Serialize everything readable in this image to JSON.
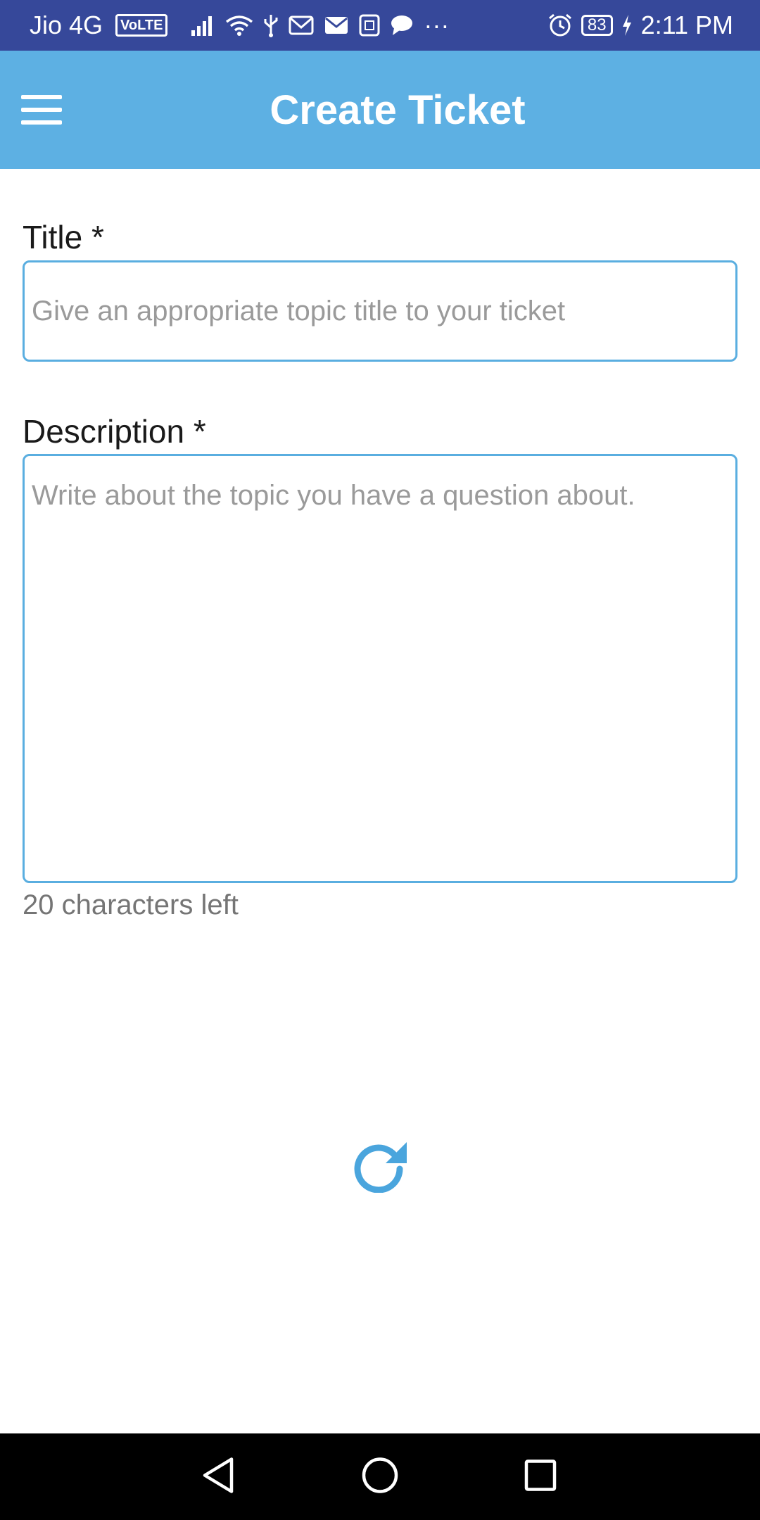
{
  "status_bar": {
    "carrier": "Jio 4G",
    "volte_badge": "VoLTE",
    "battery_level": "83",
    "time": "2:11 PM",
    "overflow_dots": "···",
    "icons": [
      "signal-icon",
      "wifi-icon",
      "usb-icon",
      "gmail-icon",
      "mail-icon",
      "sim-icon",
      "chat-icon",
      "alarm-icon",
      "battery-icon",
      "charging-icon"
    ]
  },
  "app_bar": {
    "title": "Create Ticket",
    "background_color": "#5db0e3",
    "menu_icon": "hamburger-menu-icon"
  },
  "form": {
    "title_field": {
      "label": "Title *",
      "value": "",
      "placeholder": "Give an appropriate topic title to your ticket"
    },
    "description_field": {
      "label": "Description *",
      "value": "",
      "placeholder": "Write about the topic you have a question about."
    },
    "char_counter": "20 characters left",
    "accent_color": "#5aaee0"
  },
  "refresh_icon": "refresh-icon",
  "nav_bar": {
    "icons": [
      "back-icon",
      "home-icon",
      "recents-icon"
    ]
  }
}
